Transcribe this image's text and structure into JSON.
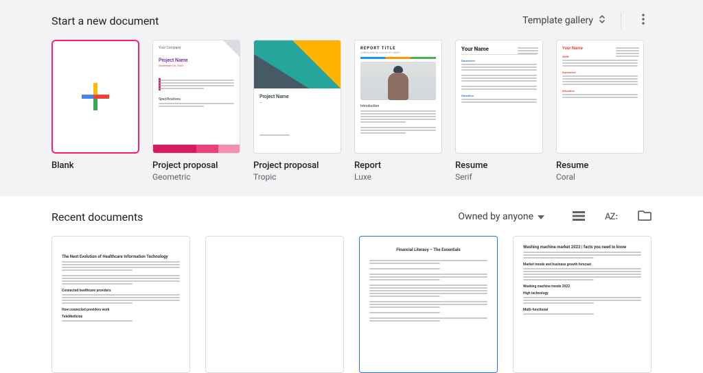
{
  "startSection": {
    "title": "Start a new document",
    "galleryLabel": "Template gallery"
  },
  "templates": [
    {
      "title": "Blank",
      "subtitle": ""
    },
    {
      "title": "Project proposal",
      "subtitle": "Geometric"
    },
    {
      "title": "Project proposal",
      "subtitle": "Tropic"
    },
    {
      "title": "Report",
      "subtitle": "Luxe"
    },
    {
      "title": "Resume",
      "subtitle": "Serif"
    },
    {
      "title": "Resume",
      "subtitle": "Coral"
    }
  ],
  "tpl1": {
    "company": "Your Company",
    "name": "Project Name",
    "date": "September 04, 20XX",
    "spec": "Specifications"
  },
  "tpl2": {
    "name": "Project Name"
  },
  "tpl3": {
    "title": "REPORT TITLE",
    "sub": "LOREM IPSUM DOLOR SIT AMET",
    "intro": "Introduction"
  },
  "tpl4": {
    "name": "Your Name",
    "exp": "Experience",
    "edu": "Education"
  },
  "tpl5": {
    "name": "Your Name",
    "skills": "Skills",
    "exp": "Experience",
    "edu": "Education"
  },
  "recent": {
    "title": "Recent documents",
    "ownedLabel": "Owned by anyone",
    "sortLabel": "AZ"
  },
  "docs": [
    {
      "title": "The Next Evolution of Healthcare Information Technology",
      "h1": "Connected healthcare providers",
      "h2": "How connected providers work",
      "h3": "TeleMedicine"
    },
    {
      "title": ""
    },
    {
      "title": "Financial Literacy – The Essentials"
    },
    {
      "title": "Washing machine market 2022 | facts you need to know",
      "h1": "Market trends and business growth forecast",
      "h2": "Washing machine trends 2022",
      "h3": "High technology",
      "h4": "Multi-functional"
    }
  ]
}
